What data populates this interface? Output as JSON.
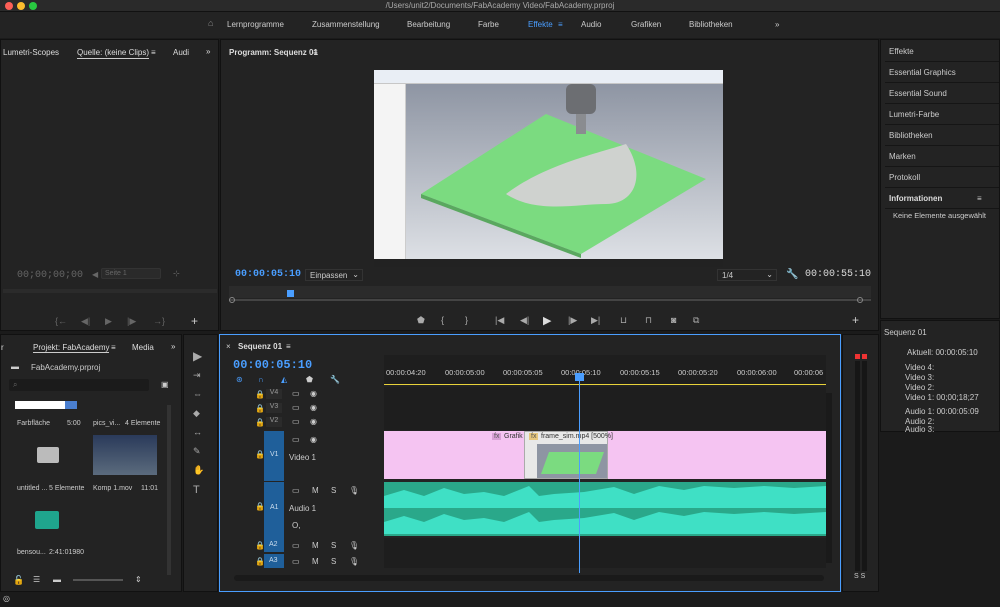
{
  "window": {
    "title": "/Users/unit2/Documents/FabAcademy Video/FabAcademy.prproj"
  },
  "workspaces": [
    "Lernprogramme",
    "Zusammenstellung",
    "Bearbeitung",
    "Farbe",
    "Effekte",
    "Audio",
    "Grafiken",
    "Bibliotheken"
  ],
  "workspace_active": "Effekte",
  "workspace_more": "»",
  "source": {
    "tabs": [
      "Lumetri-Scopes",
      "Quelle: (keine Clips)",
      "Audi"
    ],
    "timecode": "00;00;00;00",
    "page": "Seite 1"
  },
  "program": {
    "title": "Programm: Sequenz 01",
    "timecode_in": "00:00:05:10",
    "fit": "Einpassen",
    "zoom": "1/4",
    "timecode_out": "00:00:55:10"
  },
  "project": {
    "tabs": [
      "Projekt: FabAcademy",
      "Media"
    ],
    "file": "FabAcademy.prproj",
    "items": [
      {
        "name": "Farbfläche",
        "meta": "5:00"
      },
      {
        "name": "pics_vi...",
        "meta": "4 Elemente"
      },
      {
        "name": "untitled ...",
        "meta": "5 Elemente"
      },
      {
        "name": "Komp 1.mov",
        "meta": "11:01"
      },
      {
        "name": "bensou...",
        "meta": "2:41:01980"
      }
    ]
  },
  "timeline": {
    "title": "Sequenz 01",
    "timecode": "00:00:05:10",
    "ruler": [
      "00:00:04:20",
      "00:00:05:00",
      "00:00:05:05",
      "00:00:05:10",
      "00:00:05:15",
      "00:00:05:20",
      "00:00:06:00",
      "00:00:06"
    ],
    "tracks": {
      "v4": "V4",
      "v3": "V3",
      "v2": "V2",
      "v1": "V1",
      "v1_name": "Video 1",
      "a1": "A1",
      "a1_name": "Audio 1",
      "a2": "A2",
      "a3": "A3",
      "m": "M",
      "s": "S",
      "o": "O,"
    },
    "clip_grafik": "Grafik",
    "clip_video": "frame_sim.mp4 [500%]",
    "clip_fx": "fx"
  },
  "right_panel": {
    "items": [
      "Effekte",
      "Essential Graphics",
      "Essential Sound",
      "Lumetri-Farbe",
      "Bibliotheken",
      "Marken",
      "Protokoll",
      "Informationen"
    ],
    "info_empty": "Keine Elemente ausgewählt",
    "sequence": "Sequenz 01",
    "actual": "Aktuell:  00:00:05:10",
    "v4": "Video 4:",
    "v3": "Video 3:",
    "v2": "Video 2:",
    "v1": "Video 1:  00;00;18;27",
    "a1": "Audio 1:  00:00:05:09",
    "a2": "Audio 2:",
    "a3": "Audio 3:"
  },
  "meter_labels": "S S",
  "colors": {
    "accent": "#4a9eff",
    "clip_pink": "#f5c4f2",
    "audio": "#3fe0c5",
    "green_model": "#77d97e"
  }
}
